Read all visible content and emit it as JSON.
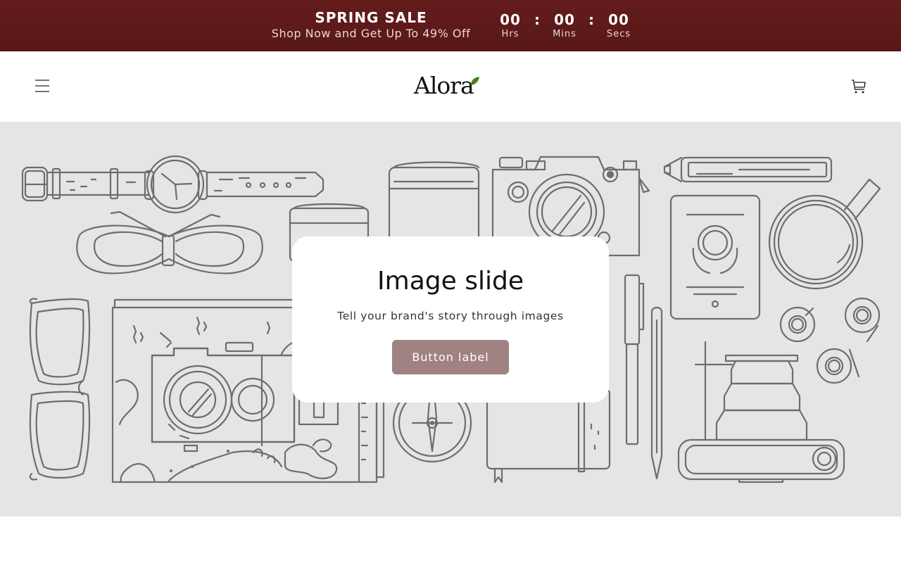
{
  "announcement": {
    "title": "SPRING SALE",
    "subtitle": "Shop Now and Get Up To 49% Off",
    "countdown": [
      {
        "value": "00",
        "label": "Hrs"
      },
      {
        "value": "00",
        "label": "Mins"
      },
      {
        "value": "00",
        "label": "Secs"
      }
    ],
    "separator": ":",
    "colors": {
      "background": "#5e1a1a",
      "text": "#ffffff"
    }
  },
  "header": {
    "logo_text": "Alora",
    "menu_icon": "hamburger-menu-icon",
    "cart_icon": "shopping-cart-icon"
  },
  "hero": {
    "title": "Image slide",
    "text": "Tell your brand's story through images",
    "button_label": "Button label",
    "colors": {
      "background": "#e5e5e5",
      "button": "#a08283"
    }
  }
}
